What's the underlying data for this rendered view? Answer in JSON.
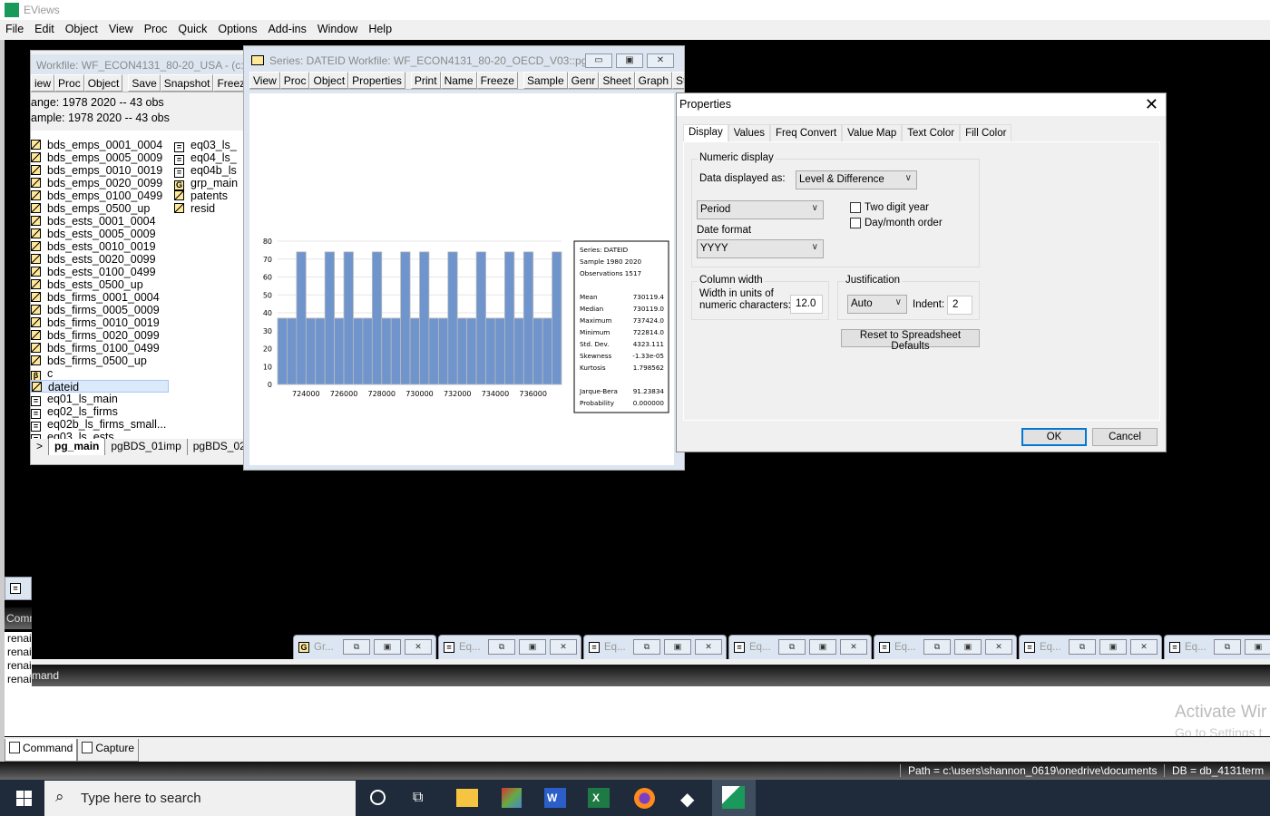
{
  "app": {
    "title": "EViews",
    "menu": [
      "File",
      "Edit",
      "Object",
      "View",
      "Proc",
      "Quick",
      "Options",
      "Add-ins",
      "Window",
      "Help"
    ]
  },
  "workfile": {
    "title": "Workfile: WF_ECON4131_80-20_USA - (c:\\u",
    "toolbar": [
      "iew",
      "Proc",
      "Object",
      "Save",
      "Snapshot",
      "Freeze",
      "D"
    ],
    "range": "ange:  1978 2020  --  43 obs",
    "sample": "ample: 1978 2020  --  43 obs",
    "col1": [
      {
        "n": "bds_emps_0001_0004",
        "t": "series"
      },
      {
        "n": "bds_emps_0005_0009",
        "t": "series"
      },
      {
        "n": "bds_emps_0010_0019",
        "t": "series"
      },
      {
        "n": "bds_emps_0020_0099",
        "t": "series"
      },
      {
        "n": "bds_emps_0100_0499",
        "t": "series"
      },
      {
        "n": "bds_emps_0500_up",
        "t": "series"
      },
      {
        "n": "bds_ests_0001_0004",
        "t": "series"
      },
      {
        "n": "bds_ests_0005_0009",
        "t": "series"
      },
      {
        "n": "bds_ests_0010_0019",
        "t": "series"
      },
      {
        "n": "bds_ests_0020_0099",
        "t": "series"
      },
      {
        "n": "bds_ests_0100_0499",
        "t": "series"
      },
      {
        "n": "bds_ests_0500_up",
        "t": "series"
      },
      {
        "n": "bds_firms_0001_0004",
        "t": "series"
      },
      {
        "n": "bds_firms_0005_0009",
        "t": "series"
      },
      {
        "n": "bds_firms_0010_0019",
        "t": "series"
      },
      {
        "n": "bds_firms_0020_0099",
        "t": "series"
      },
      {
        "n": "bds_firms_0100_0499",
        "t": "series"
      },
      {
        "n": "bds_firms_0500_up",
        "t": "series"
      },
      {
        "n": "c",
        "t": "coef"
      },
      {
        "n": "dateid",
        "t": "series"
      },
      {
        "n": "eq01_ls_main",
        "t": "equation"
      },
      {
        "n": "eq02_ls_firms",
        "t": "equation"
      },
      {
        "n": "eq02b_ls_firms_small...",
        "t": "equation"
      },
      {
        "n": "eq03_ls_ests",
        "t": "equation"
      }
    ],
    "col2": [
      {
        "n": "eq03_ls_",
        "t": "equation"
      },
      {
        "n": "eq04_ls_",
        "t": "equation"
      },
      {
        "n": "eq04b_ls",
        "t": "equation"
      },
      {
        "n": "grp_main",
        "t": "group"
      },
      {
        "n": "patents",
        "t": "series"
      },
      {
        "n": "resid",
        "t": "series"
      }
    ],
    "selected": "dateid",
    "pages": [
      ">",
      "pg_main",
      "pgBDS_01imp",
      "pgBDS_02s"
    ]
  },
  "series": {
    "title": "Series: DATEID   Workfile: WF_ECON4131_80-20_OECD_V03::pg_...",
    "toolbar": [
      "View",
      "Proc",
      "Object",
      "Properties",
      "Print",
      "Name",
      "Freeze",
      "Sample",
      "Genr",
      "Sheet",
      "Graph",
      "Stats",
      "I"
    ],
    "stats": {
      "series": "Series: DATEID",
      "sample": "Sample 1980 2020",
      "obs": "Observations 1517",
      "rows": [
        [
          "Mean",
          "730119.4"
        ],
        [
          "Median",
          "730119.0"
        ],
        [
          "Maximum",
          "737424.0"
        ],
        [
          "Minimum",
          "722814.0"
        ],
        [
          "Std. Dev.",
          "4323.111"
        ],
        [
          "Skewness",
          "-1.33e-05"
        ],
        [
          "Kurtosis",
          "1.798562"
        ]
      ],
      "jb": [
        [
          "Jarque-Bera",
          "91.23834"
        ],
        [
          "Probability",
          "0.000000"
        ]
      ]
    }
  },
  "chart_data": {
    "type": "bar",
    "bin_start": 722500,
    "bin_width": 500,
    "values": [
      37,
      37,
      74,
      37,
      37,
      74,
      37,
      74,
      37,
      37,
      74,
      37,
      37,
      74,
      37,
      74,
      37,
      37,
      74,
      37,
      37,
      74,
      37,
      37,
      74,
      37,
      74,
      37,
      37,
      74
    ],
    "xticks": [
      "724000",
      "726000",
      "728000",
      "730000",
      "732000",
      "734000",
      "736000"
    ],
    "xtick_values": [
      724000,
      726000,
      728000,
      730000,
      732000,
      734000,
      736000
    ],
    "xlim": [
      722500,
      737500
    ],
    "ylim": [
      0,
      80
    ],
    "yticks": [
      "0",
      "10",
      "20",
      "30",
      "40",
      "50",
      "60",
      "70",
      "80"
    ],
    "grid": true,
    "bar_color": "#7094cc"
  },
  "properties": {
    "title": "Properties",
    "tabs": [
      "Display",
      "Values",
      "Freq Convert",
      "Value Map",
      "Text Color",
      "Fill Color"
    ],
    "numeric_display": "Numeric display",
    "data_displayed_as": "Data displayed as:",
    "data_displayed_value": "Level & Difference",
    "period": "Period",
    "date_format_label": "Date format",
    "date_format": "YYYY",
    "two_digit_year": "Two digit year",
    "day_month": "Day/month order",
    "two_digit_checked": false,
    "day_month_checked": false,
    "column_width": "Column width",
    "width_label1": "Width in units of",
    "width_label2": "numeric characters:",
    "width_value": "12.0",
    "justification": "Justification",
    "just_value": "Auto",
    "indent_label": "Indent:",
    "indent_value": "2",
    "reset": "Reset to Spreadsheet Defaults",
    "ok": "OK",
    "cancel": "Cancel"
  },
  "minimized": [
    {
      "icon": "G",
      "label": "Gr..."
    },
    {
      "icon": "=",
      "label": "Eq..."
    },
    {
      "icon": "=",
      "label": "Eq..."
    },
    {
      "icon": "=",
      "label": "Eq..."
    },
    {
      "icon": "=",
      "label": "Eq..."
    },
    {
      "icon": "=",
      "label": "Eq..."
    },
    {
      "icon": "=",
      "label": "Eq..."
    }
  ],
  "command": {
    "header": "Command",
    "header_left": "Comm",
    "lines": [
      "renai",
      "renai",
      "renai",
      "renai",
      "renai"
    ],
    "header2": "mand",
    "tabs": [
      "Command",
      "Capture"
    ],
    "watermark1": "Activate Wir",
    "watermark2": "Go to Settings t"
  },
  "status": {
    "path": "Path = c:\\users\\shannon_0619\\onedrive\\documents",
    "db": "DB = db_4131term"
  },
  "taskbar": {
    "search": "Type here to search"
  }
}
